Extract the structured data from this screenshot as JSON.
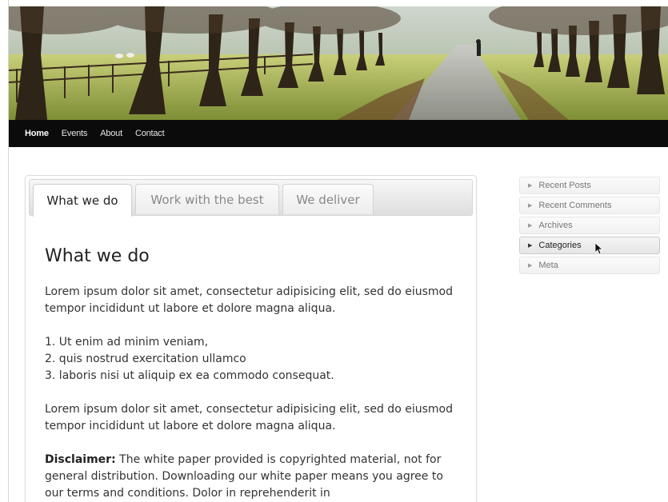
{
  "nav": {
    "items": [
      {
        "label": "Home"
      },
      {
        "label": "Events"
      },
      {
        "label": "About"
      },
      {
        "label": "Contact"
      }
    ]
  },
  "tabs": {
    "items": [
      {
        "label": "What we do"
      },
      {
        "label": "Work with the best"
      },
      {
        "label": "We deliver"
      }
    ],
    "active_index": 0
  },
  "content": {
    "heading": "What we do",
    "paragraph1": "Lorem ipsum dolor sit amet, consectetur adipisicing elit, sed do eiusmod tempor incididunt ut labore et dolore magna aliqua.",
    "list": [
      "1. Ut enim ad minim veniam,",
      "2. quis nostrud exercitation ullamco",
      "3. laboris nisi ut aliquip ex ea commodo consequat."
    ],
    "paragraph2": "Lorem ipsum dolor sit amet, consectetur adipisicing elit, sed do eiusmod tempor incididunt ut labore et dolore magna aliqua.",
    "disclaimer_label": "Disclaimer:",
    "disclaimer_text": " The white paper provided is copyrighted material, not for general distribution. Downloading our white paper means you agree to our terms and conditions. Dolor in reprehenderit in"
  },
  "sidebar": {
    "widgets": [
      {
        "label": "Recent Posts"
      },
      {
        "label": "Recent Comments"
      },
      {
        "label": "Archives"
      },
      {
        "label": "Categories"
      },
      {
        "label": "Meta"
      }
    ],
    "hovered_index": 3
  },
  "colors": {
    "nav_bg": "#0b0b0b",
    "page_bg": "#ffffff"
  }
}
